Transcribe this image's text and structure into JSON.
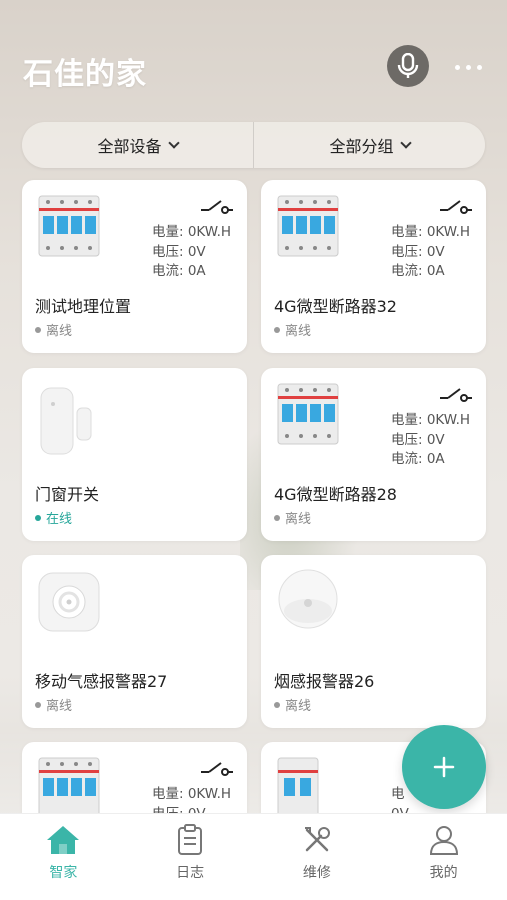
{
  "header": {
    "title": "石佳的家"
  },
  "filters": {
    "devices": "全部设备",
    "groups": "全部分组"
  },
  "metric_labels": {
    "energy": "电量: ",
    "voltage": "电压: ",
    "current": "电流: "
  },
  "cards": [
    {
      "name": "测试地理位置",
      "status": "离线",
      "type": "breaker",
      "energy": "0KW.H",
      "voltage": "0V",
      "current": "0A"
    },
    {
      "name": "4G微型断路器32",
      "status": "离线",
      "type": "breaker",
      "energy": "0KW.H",
      "voltage": "0V",
      "current": "0A"
    },
    {
      "name": "门窗开关",
      "status": "在线",
      "type": "door-sensor"
    },
    {
      "name": "4G微型断路器28",
      "status": "离线",
      "type": "breaker",
      "energy": "0KW.H",
      "voltage": "0V",
      "current": "0A"
    },
    {
      "name": "移动气感报警器27",
      "status": "离线",
      "type": "gas-alarm"
    },
    {
      "name": "烟感报警器26",
      "status": "离线",
      "type": "smoke-alarm"
    },
    {
      "type": "breaker",
      "energy": "0KW.H",
      "voltage": "0V"
    },
    {
      "type": "breaker"
    }
  ],
  "partial": {
    "v1_label": "电",
    "v1_value": "0V"
  },
  "tabs": [
    {
      "label": "智家",
      "icon": "home-icon",
      "active": true
    },
    {
      "label": "日志",
      "icon": "clipboard-icon"
    },
    {
      "label": "维修",
      "icon": "tools-icon"
    },
    {
      "label": "我的",
      "icon": "user-icon"
    }
  ],
  "colors": {
    "accent": "#3bb5a8",
    "offline": "#999999",
    "online": "#26a69a",
    "card": "#ffffff"
  }
}
